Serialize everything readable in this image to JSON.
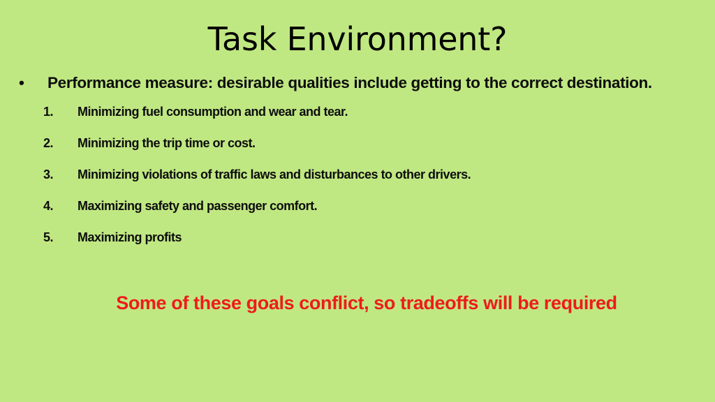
{
  "slide": {
    "background_color": "#c0e882",
    "title": "Task Environment?",
    "body": {
      "bullet_glyph": "•",
      "bullet_text": "Performance measure: desirable qualities include getting to the correct destination.",
      "numbered_items": [
        {
          "marker": "1.",
          "text": "Minimizing fuel consumption and wear and tear."
        },
        {
          "marker": "2.",
          "text": "Minimizing the trip time or cost."
        },
        {
          "marker": "3.",
          "text": "Minimizing violations of traffic laws and disturbances to other drivers."
        },
        {
          "marker": "4.",
          "text": "Maximizing safety and passenger comfort."
        },
        {
          "marker": "5.",
          "text": "Maximizing profits"
        }
      ],
      "closing_note": {
        "text": "Some of these goals conflict, so tradeoffs will be required",
        "color": "#ed1c1c"
      }
    }
  }
}
